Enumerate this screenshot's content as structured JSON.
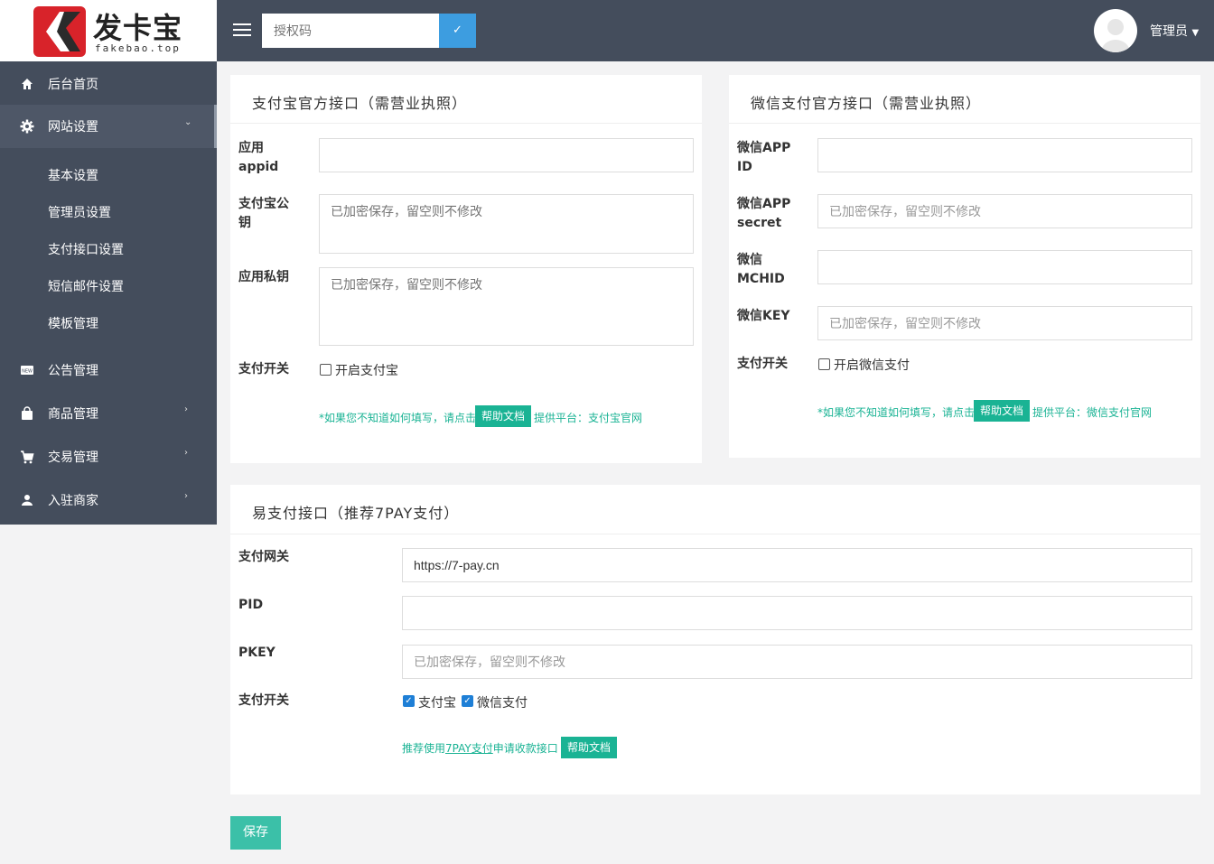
{
  "brand": {
    "name": "发卡宝",
    "sub": "fakebao.top"
  },
  "topbar": {
    "auth_placeholder": "授权码",
    "admin": "管理员"
  },
  "sidebar": {
    "items": [
      {
        "label": "后台首页",
        "icon": "home-icon"
      },
      {
        "label": "网站设置",
        "icon": "gear-icon"
      },
      {
        "label": "公告管理",
        "icon": "news-icon"
      },
      {
        "label": "商品管理",
        "icon": "bag-icon"
      },
      {
        "label": "交易管理",
        "icon": "cart-icon"
      },
      {
        "label": "入驻商家",
        "icon": "user-icon"
      }
    ],
    "sub": [
      "基本设置",
      "管理员设置",
      "支付接口设置",
      "短信邮件设置",
      "模板管理"
    ]
  },
  "alipay": {
    "title": "支付宝官方接口（需营业执照）",
    "appid_label": "应用appid",
    "pubkey_label": "支付宝公钥",
    "privkey_label": "应用私钥",
    "switch_label": "支付开关",
    "switch_text": "开启支付宝",
    "enc_placeholder": "已加密保存，留空则不修改",
    "hint_pre": "*如果您不知道如何填写，请点击",
    "help": "帮助文档",
    "hint_post": " 提供平台：支付宝官网"
  },
  "wechat": {
    "title": "微信支付官方接口（需营业执照）",
    "appid_label": "微信APP ID",
    "secret_label": "微信APP secret",
    "mchid_label": "微信MCHID",
    "key_label": "微信KEY",
    "switch_label": "支付开关",
    "switch_text": "开启微信支付",
    "enc_placeholder": "已加密保存，留空则不修改",
    "hint_pre": "*如果您不知道如何填写，请点击",
    "help": "帮助文档",
    "hint_post": " 提供平台：微信支付官网"
  },
  "epay": {
    "title": "易支付接口（推荐7PAY支付）",
    "gateway_label": "支付网关",
    "gateway_value": "https://7-pay.cn",
    "pid_label": "PID",
    "pkey_label": "PKEY",
    "enc_placeholder": "已加密保存，留空则不修改",
    "switch_label": "支付开关",
    "opt_alipay": "支付宝",
    "opt_wechat": "微信支付",
    "hint_pre": "推荐使用",
    "hint_link": "7PAY支付",
    "hint_post": "申请收款接口",
    "help": "帮助文档"
  },
  "save": "保存",
  "colors": {
    "sidebar": "#444d5c",
    "accent": "#1ab394",
    "blue": "#3d9de0"
  }
}
